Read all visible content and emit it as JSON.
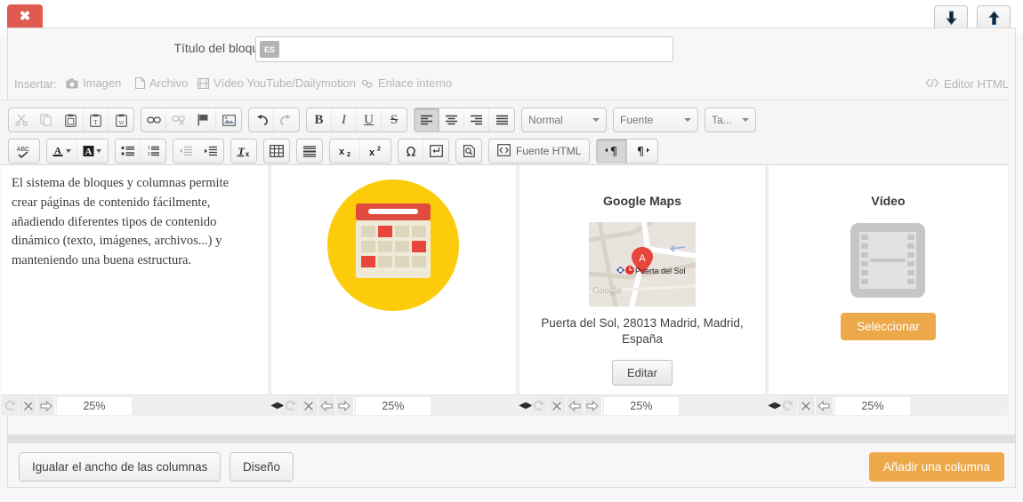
{
  "window": {
    "close_label": "✖",
    "move_down_icon": "arrow-down-icon",
    "move_up_icon": "arrow-up-icon"
  },
  "title_row": {
    "label": "Título del bloque",
    "lang_badge": "ES",
    "value": "",
    "placeholder": ""
  },
  "insert_bar": {
    "label": "Insertar:",
    "items": [
      {
        "label": "Imagen",
        "icon": "camera-icon"
      },
      {
        "label": "Archivo",
        "icon": "file-icon"
      },
      {
        "label": "Vídeo YouTube/Dailymotion",
        "icon": "film-strip-icon"
      },
      {
        "label": "Enlace interno",
        "icon": "link-chain-icon"
      }
    ],
    "html_editor_label": "Editor HTML",
    "html_editor_icon": "code-brackets-icon"
  },
  "toolbar": {
    "row1": [
      {
        "group": [
          {
            "name": "cut-button",
            "icon": "scissors-icon",
            "disabled": true
          },
          {
            "name": "copy-button",
            "icon": "copy-icon",
            "disabled": true
          },
          {
            "name": "paste-button",
            "icon": "clipboard-icon",
            "disabled": false
          },
          {
            "name": "paste-as-text-button",
            "icon": "clipboard-text-icon",
            "disabled": false
          },
          {
            "name": "paste-from-word-button",
            "icon": "clipboard-word-icon",
            "disabled": false
          }
        ]
      },
      {
        "group": [
          {
            "name": "link-button",
            "icon": "link-icon",
            "disabled": false
          },
          {
            "name": "unlink-button",
            "icon": "unlink-icon",
            "disabled": true
          },
          {
            "name": "anchor-button",
            "icon": "flag-icon",
            "disabled": false
          },
          {
            "name": "image-button",
            "icon": "image-icon",
            "disabled": false
          }
        ]
      },
      {
        "group": [
          {
            "name": "undo-button",
            "icon": "undo-arrow-icon",
            "disabled": false
          },
          {
            "name": "redo-button",
            "icon": "redo-arrow-icon",
            "disabled": true
          }
        ]
      },
      {
        "group": [
          {
            "name": "bold-button",
            "icon": "bold-icon",
            "glyph": "B",
            "disabled": false
          },
          {
            "name": "italic-button",
            "icon": "italic-icon",
            "glyph": "I",
            "disabled": false
          },
          {
            "name": "underline-button",
            "icon": "underline-icon",
            "glyph": "U",
            "disabled": false
          },
          {
            "name": "strikethrough-button",
            "icon": "strikethrough-icon",
            "glyph": "S",
            "disabled": false
          }
        ]
      },
      {
        "group": [
          {
            "name": "align-left-button",
            "icon": "align-left-icon",
            "active": true
          },
          {
            "name": "align-center-button",
            "icon": "align-center-icon"
          },
          {
            "name": "align-right-button",
            "icon": "align-right-icon"
          },
          {
            "name": "align-justify-button",
            "icon": "align-justify-icon"
          }
        ]
      }
    ],
    "selects": [
      {
        "name": "paragraph-format-select",
        "value": "Normal"
      },
      {
        "name": "font-family-select",
        "value": "Fuente"
      },
      {
        "name": "font-size-select",
        "value": "Ta..."
      }
    ],
    "row2": [
      {
        "group": [
          {
            "name": "spellcheck-button",
            "icon": "abc-check-icon"
          }
        ]
      },
      {
        "group": [
          {
            "name": "text-color-button",
            "icon": "text-color-icon"
          },
          {
            "name": "background-color-button",
            "icon": "background-color-icon"
          }
        ]
      },
      {
        "group": [
          {
            "name": "bulleted-list-button",
            "icon": "bulleted-list-icon"
          },
          {
            "name": "numbered-list-button",
            "icon": "numbered-list-icon"
          }
        ]
      },
      {
        "group": [
          {
            "name": "outdent-button",
            "icon": "outdent-icon",
            "disabled": true
          },
          {
            "name": "indent-button",
            "icon": "indent-icon",
            "disabled": false
          }
        ]
      },
      {
        "group": [
          {
            "name": "remove-format-button",
            "icon": "remove-format-icon"
          }
        ]
      },
      {
        "group": [
          {
            "name": "table-button",
            "icon": "table-icon"
          }
        ]
      },
      {
        "group": [
          {
            "name": "horizontal-rule-button",
            "icon": "horizontal-rule-icon"
          }
        ]
      },
      {
        "group": [
          {
            "name": "subscript-button",
            "icon": "subscript-icon"
          },
          {
            "name": "superscript-button",
            "icon": "superscript-icon"
          }
        ]
      },
      {
        "group": [
          {
            "name": "special-character-button",
            "icon": "omega-icon"
          },
          {
            "name": "page-break-button",
            "icon": "page-break-icon"
          }
        ]
      },
      {
        "group": [
          {
            "name": "preview-button",
            "icon": "preview-icon"
          }
        ]
      }
    ],
    "html_source_label": "Fuente HTML",
    "html_source_icon": "source-code-icon",
    "ltr_icon": "text-direction-ltr-icon",
    "rtl_icon": "text-direction-rtl-icon"
  },
  "columns": [
    {
      "name": "column-text",
      "type": "text",
      "body": "El sistema de bloques y columnas permite crear páginas de contenido fácilmente, añadiendo diferentes tipos de contenido dinámico (texto, imágenes, archivos...) y manteniendo una buena estructura.",
      "width_pct": "25%",
      "controls": [
        "reset-icon",
        "delete-icon",
        "move-right-icon"
      ],
      "has_left_resize": false
    },
    {
      "name": "column-image",
      "type": "image",
      "image_alt": "calendar-illustration",
      "width_pct": "25%",
      "controls": [
        "reset-icon",
        "delete-icon",
        "move-left-icon",
        "move-right-icon"
      ],
      "has_left_resize": true
    },
    {
      "name": "column-map",
      "type": "map",
      "heading": "Google Maps",
      "map_marker_label": "A",
      "map_place_label": "Puerta del Sol",
      "map_watermark": "Google",
      "caption": "Puerta del Sol, 28013 Madrid, Madrid, España",
      "button_label": "Editar",
      "width_pct": "25%",
      "controls": [
        "reset-icon",
        "delete-icon",
        "move-left-icon",
        "move-right-icon"
      ],
      "has_left_resize": true
    },
    {
      "name": "column-video",
      "type": "video",
      "heading": "Vídeo",
      "placeholder_icon": "film-placeholder-icon",
      "button_label": "Seleccionar",
      "width_pct": "25%",
      "controls": [
        "reset-icon",
        "delete-icon",
        "move-left-icon"
      ],
      "has_left_resize": true
    }
  ],
  "footer": {
    "equalize_label": "Igualar el ancho de las columnas",
    "design_label": "Diseño",
    "add_column_label": "Añadir una columna"
  },
  "colors": {
    "close_red": "#e05a4f",
    "accent_orange": "#eda84a",
    "panel_bg": "#f7f7f7",
    "column_bg": "#ffffff",
    "muted_text": "#b5b5b5"
  }
}
